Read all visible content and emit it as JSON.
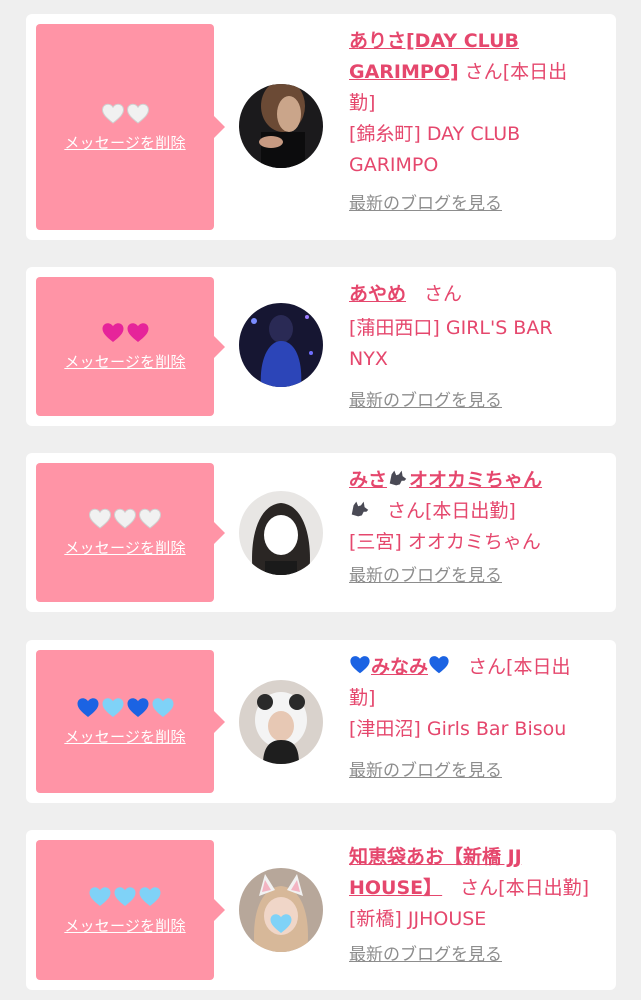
{
  "delete_label": "メッセージを削除",
  "blog_label": "最新のブログを見る",
  "suffix": "さん",
  "colors": {
    "accent": "#e5476d",
    "panel": "#ff94a6",
    "link_gray": "#8d8d8d"
  },
  "cards": [
    {
      "hearts": [
        "white-heart",
        "white-heart"
      ],
      "name_line1": "ありさ[DAY CLUB",
      "name_line2": "GARIMPO]",
      "status_tail": "[本日出",
      "status_wrap": "勤]",
      "shop_line1": "[錦糸町] DAY CLUB",
      "shop_line2": "GARIMPO"
    },
    {
      "hearts": [
        "pink-heart",
        "pink-heart"
      ],
      "name_line1": "あやめ",
      "shop_line1": "[蒲田西口] GIRL'S BAR",
      "shop_line2": "NYX"
    },
    {
      "hearts": [
        "white-heart",
        "white-heart",
        "white-heart"
      ],
      "name_line1": "みさ",
      "name_line1_rest": "オオカミちゃん",
      "status": "[本日出勤]",
      "shop_line1": "[三宮] オオカミちゃん"
    },
    {
      "hearts": [
        "blue-heart",
        "light-blue-heart",
        "blue-heart",
        "light-blue-heart"
      ],
      "name_line1": "みなみ",
      "status_tail": "[本日出",
      "status_wrap": "勤]",
      "shop_line1": "[津田沼] Girls Bar Bisou"
    },
    {
      "hearts": [
        "light-blue-heart",
        "light-blue-heart",
        "light-blue-heart"
      ],
      "name_line1": "知恵袋あお【新橋 JJ",
      "name_line2": "HOUSE】",
      "status": "[本日出勤]",
      "shop_line1": "[新橋] JJHOUSE"
    }
  ]
}
